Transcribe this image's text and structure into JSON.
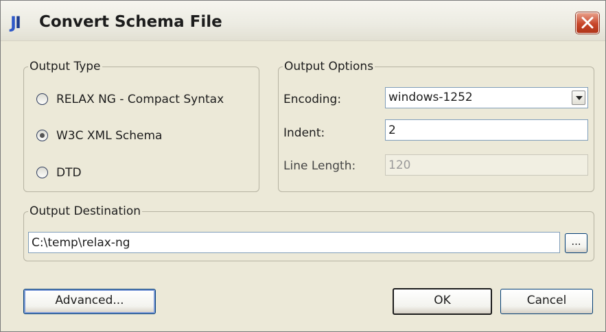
{
  "window": {
    "title": "Convert Schema File",
    "app_icon": "intellij-idea-icon",
    "close_icon": "close-icon"
  },
  "output_type": {
    "legend": "Output Type",
    "options": [
      {
        "label": "RELAX NG - Compact Syntax",
        "selected": false
      },
      {
        "label": "W3C XML Schema",
        "selected": true
      },
      {
        "label": "DTD",
        "selected": false
      }
    ]
  },
  "output_options": {
    "legend": "Output Options",
    "encoding_label": "Encoding:",
    "encoding_value": "windows-1252",
    "indent_label": "Indent:",
    "indent_value": "2",
    "line_length_label": "Line Length:",
    "line_length_value": "120"
  },
  "output_destination": {
    "legend": "Output Destination",
    "path": "C:\\temp\\relax-ng",
    "browse_label": "..."
  },
  "buttons": {
    "advanced": "Advanced...",
    "ok": "OK",
    "cancel": "Cancel"
  },
  "colors": {
    "dialog_background": "#ece9d8",
    "close_button": "#c8462a",
    "input_border": "#7f9db9"
  }
}
